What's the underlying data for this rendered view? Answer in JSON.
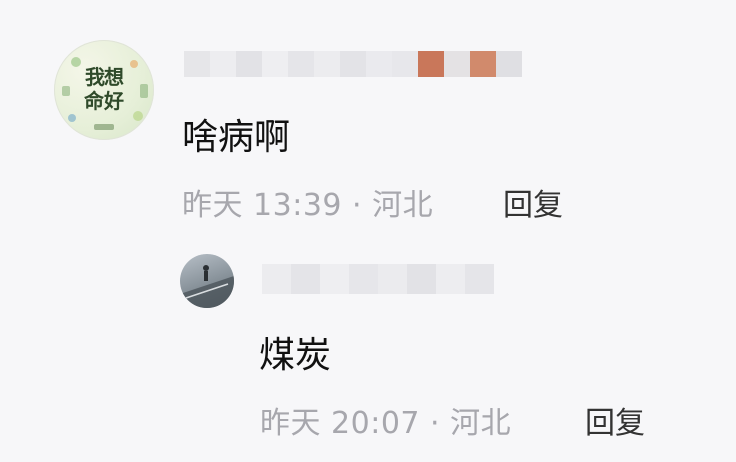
{
  "comments": [
    {
      "text": "啥病啊",
      "time": "昨天 13:39 · 河北",
      "reply_label": "回复",
      "avatar_text_line1": "我想",
      "avatar_text_line2": "命好"
    },
    {
      "text": "煤炭",
      "time": "昨天 20:07 · 河北",
      "reply_label": "回复"
    }
  ],
  "colors": {
    "background": "#f7f7f9",
    "comment_text": "#111111",
    "meta_text": "#a7a7ad",
    "reply_label": "#333333"
  }
}
